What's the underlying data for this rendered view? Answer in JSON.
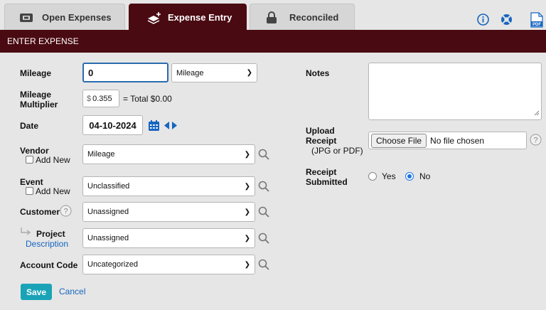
{
  "tabs": [
    {
      "label": "Open Expenses",
      "icon": "wallet-icon",
      "active": false
    },
    {
      "label": "Expense Entry",
      "icon": "stack-plus-icon",
      "active": true
    },
    {
      "label": "Reconciled",
      "icon": "lock-icon",
      "active": false
    }
  ],
  "top_icons": [
    "info-icon",
    "help-life-ring-icon",
    "pdf-icon"
  ],
  "toolbar_text": {
    "pdf": "PDF"
  },
  "header": {
    "title": "ENTER EXPENSE"
  },
  "form": {
    "mileage_label": "Mileage",
    "mileage_value": "0",
    "mileage_type": "Mileage",
    "multiplier_label_line1": "Mileage",
    "multiplier_label_line2": "Multiplier",
    "currency_symbol": "$",
    "multiplier_value": "0.355",
    "total_text": "= Total $0.00",
    "date_label": "Date",
    "date_value": "04-10-2024",
    "vendor_label": "Vendor",
    "vendor_add_new": "Add New",
    "vendor_value": "Mileage",
    "event_label": "Event",
    "event_add_new": "Add New",
    "event_value": "Unclassified",
    "customer_label": "Customer",
    "customer_value": "Unassigned",
    "project_label": "Project",
    "project_description_link": "Description",
    "project_value": "Unassigned",
    "account_code_label": "Account Code",
    "account_code_value": "Uncategorized",
    "notes_label": "Notes",
    "notes_value": "",
    "upload_label_line1": "Upload",
    "upload_label_line2": "Receipt",
    "upload_label_line3": "(JPG or PDF)",
    "choose_file_button": "Choose File",
    "no_file_text": "No file chosen",
    "receipt_submitted_line1": "Receipt",
    "receipt_submitted_line2": "Submitted",
    "yes_label": "Yes",
    "no_label": "No",
    "receipt_submitted_value": "No"
  },
  "actions": {
    "save": "Save",
    "cancel": "Cancel"
  }
}
